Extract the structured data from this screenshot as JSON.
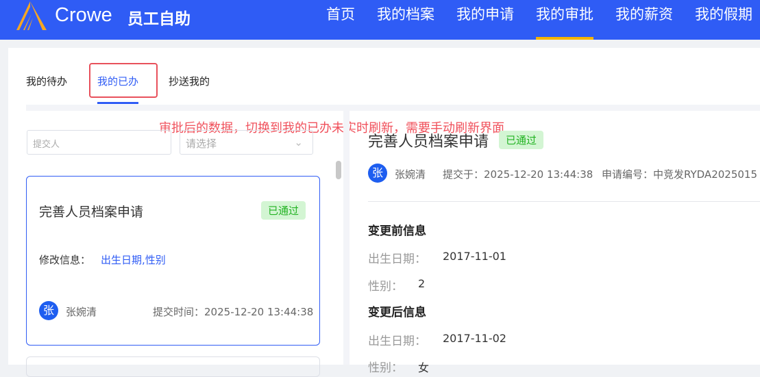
{
  "header": {
    "brand": "Crowe",
    "app_title": "员工自助",
    "nav": [
      "首页",
      "我的档案",
      "我的申请",
      "我的审批",
      "我的薪资",
      "我的假期"
    ],
    "active_nav": 3
  },
  "tabs": [
    "我的待办",
    "我的已办",
    "抄送我的"
  ],
  "annotation": "审批后的数据，切换到我的已办未实时刷新，需要手动刷新界面",
  "filters": {
    "submitter_placeholder": "提交人",
    "status_placeholder": "请选择"
  },
  "list_item": {
    "title": "完善人员档案申请",
    "status": "已通过",
    "modify_label": "修改信息：",
    "modify_value": "出生日期,性别",
    "avatar": "张",
    "name": "张婉清",
    "time_label": "提交时间：",
    "time": "2025-12-20 13:44:38"
  },
  "detail": {
    "title": "完善人员档案申请",
    "status": "已通过",
    "avatar": "张",
    "name": "张婉清",
    "submitted_label": "提交于：",
    "submitted": "2025-12-20 13:44:38",
    "no_label": "申请编号：",
    "no": "中竞发RYDA2025015",
    "before_title": "变更前信息",
    "before": [
      {
        "label": "出生日期：",
        "value": "2017-11-01"
      },
      {
        "label": "性别：",
        "value": "2"
      }
    ],
    "after_title": "变更后信息",
    "after": [
      {
        "label": "出生日期：",
        "value": "2017-11-02"
      },
      {
        "label": "性别：",
        "value": "女"
      }
    ]
  },
  "colors": {
    "primary": "#2f5cf5",
    "success": "#22b322",
    "annotation": "#f0505b"
  }
}
